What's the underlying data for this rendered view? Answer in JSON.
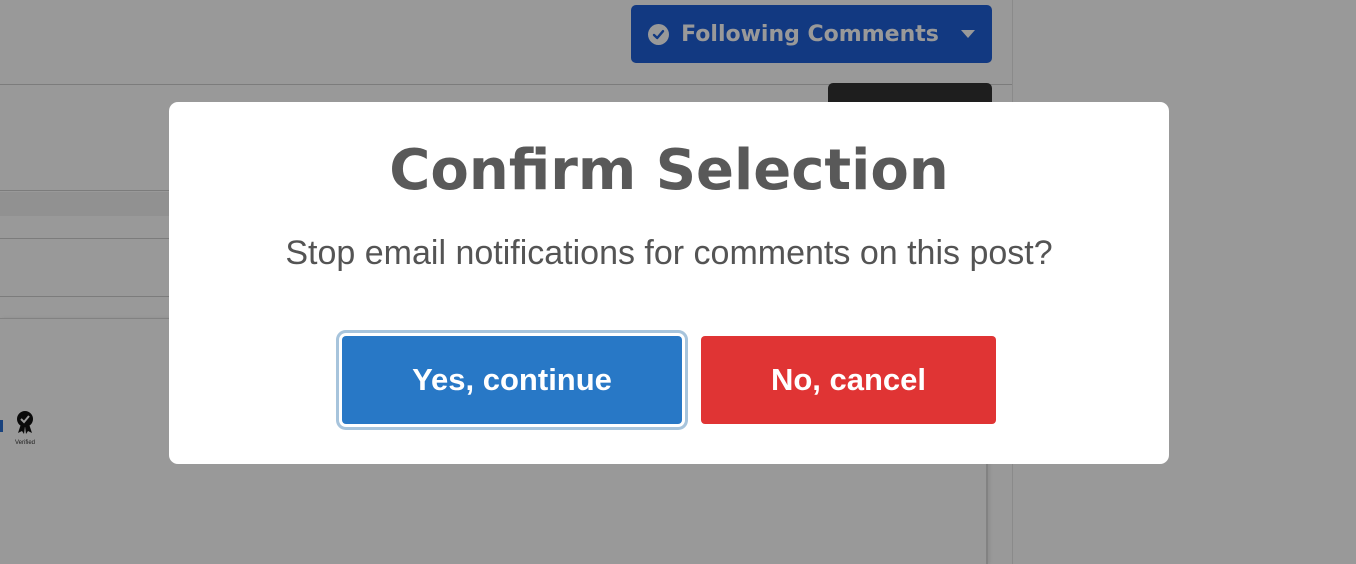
{
  "page": {
    "follow_button": {
      "label": "Following Comments",
      "color": "#1f5fd8"
    },
    "badge": {
      "label": "Verified",
      "icon": "award-ribbon-icon"
    }
  },
  "modal": {
    "title": "Confirm Selection",
    "message": "Stop email notifications for comments on this post?",
    "confirm_label": "Yes, continue",
    "cancel_label": "No, cancel",
    "confirm_color": "#2878c6",
    "cancel_color": "#e03434"
  }
}
